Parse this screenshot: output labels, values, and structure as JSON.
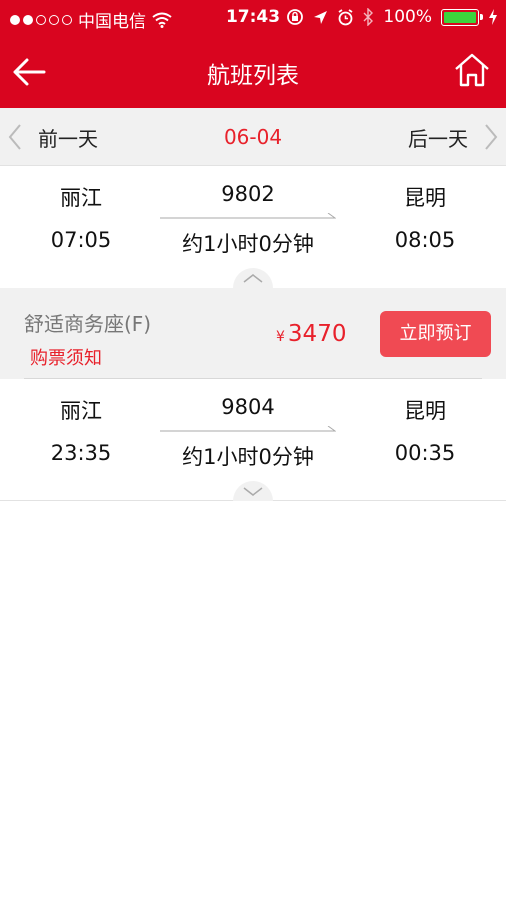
{
  "status_bar": {
    "carrier": "中国电信",
    "time": "17:43",
    "battery": "100%",
    "signal_dots_filled": 2,
    "signal_dots_total": 5
  },
  "header": {
    "title": "航班列表",
    "back_icon": "arrow-left-icon",
    "home_icon": "home-icon",
    "bg_color": "#d9051f"
  },
  "date_bar": {
    "prev_label": "前一天",
    "current_date": "06-04",
    "next_label": "后一天"
  },
  "flights": [
    {
      "from": "丽江",
      "flight_no": "9802",
      "to": "昆明",
      "depart_time": "07:05",
      "duration": "约1小时0分钟",
      "arrive_time": "08:05",
      "expanded": true
    },
    {
      "from": "丽江",
      "flight_no": "9804",
      "to": "昆明",
      "depart_time": "23:35",
      "duration": "约1小时0分钟",
      "arrive_time": "00:35",
      "expanded": false
    }
  ],
  "fare": {
    "seat_class": "舒适商务座(F)",
    "notice_label": "购票须知",
    "currency": "¥",
    "price": "3470",
    "book_label": "立即预订",
    "accent_color": "#e8212b"
  }
}
